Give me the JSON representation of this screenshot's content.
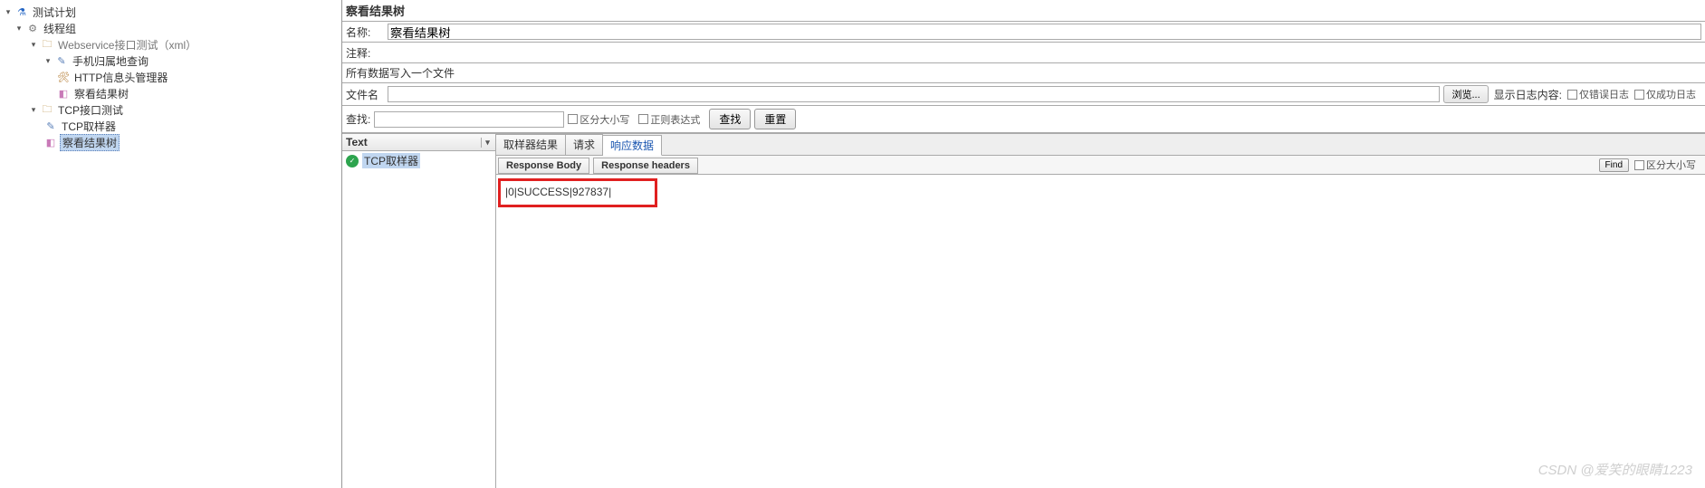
{
  "tree": {
    "root": "测试计划",
    "threadGroup": "线程组",
    "webservice": "Webservice接口测试（xml）",
    "phoneQuery": "手机归属地查询",
    "httpHeader": "HTTP信息头管理器",
    "viewResults1": "察看结果树",
    "tcpTest": "TCP接口测试",
    "tcpSampler": "TCP取样器",
    "viewResults2": "察看结果树"
  },
  "header": {
    "title": "察看结果树",
    "nameLabel": "名称:",
    "nameValue": "察看结果树",
    "commentLabel": "注释:",
    "fileSection": "所有数据写入一个文件",
    "fileLabel": "文件名",
    "browse": "浏览...",
    "logLabel": "显示日志内容:",
    "errOnly": "仅错误日志",
    "successOnly": "仅成功日志"
  },
  "search": {
    "label": "查找:",
    "caseSensitive": "区分大小写",
    "regex": "正则表达式",
    "findBtn": "查找",
    "resetBtn": "重置"
  },
  "results": {
    "typeHeader": "Text",
    "item1": "TCP取样器",
    "tabs": {
      "sampler": "取样器结果",
      "request": "请求",
      "response": "响应数据"
    },
    "subtabs": {
      "body": "Response Body",
      "headers": "Response headers"
    },
    "bodyText": "|0|SUCCESS|927837|",
    "find": "Find",
    "findCase": "区分大小写"
  },
  "watermark": "CSDN @爱笑的眼睛1223"
}
